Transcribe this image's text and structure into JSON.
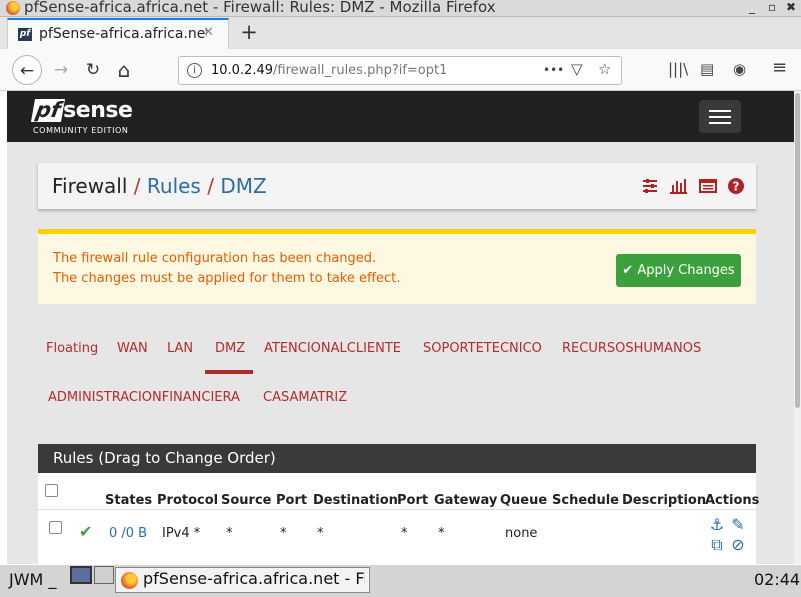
{
  "window": {
    "title": "pfSense-africa.africa.net - Firewall: Rules: DMZ - Mozilla Firefox",
    "min": "_",
    "max": "▫",
    "close": "✖"
  },
  "browser": {
    "tab_title": "pfSense-africa.africa.net -",
    "tab_close": "✕",
    "new_tab": "+",
    "url_host": "10.0.2.49",
    "url_path": "/firewall_rules.php?if=opt1",
    "back": "←",
    "forward": "→",
    "reload": "↻",
    "home": "⌂",
    "url_more": "•••",
    "pocket": "▽",
    "bookmark_star": "☆",
    "library": "|||\\",
    "sidebar": "▤",
    "account": "◉",
    "menu": "≡"
  },
  "pfsense": {
    "logo_pf": "pf",
    "logo_sense": "sense",
    "logo_edition": "COMMUNITY EDITION"
  },
  "breadcrumb": {
    "root": "Firewall",
    "sep1": "/",
    "rules": "Rules",
    "sep2": "/",
    "current": "DMZ"
  },
  "breadcrumb_icons": [
    "sliders-icon",
    "bar-chart-icon",
    "table-list-icon",
    "help-icon"
  ],
  "alert": {
    "line1": "The firewall rule configuration has been changed.",
    "line2": "The changes must be applied for them to take effect.",
    "apply_check": "✔",
    "apply_label": "Apply Changes"
  },
  "interface_tabs": {
    "row1": [
      "Floating",
      "WAN",
      "LAN",
      "DMZ",
      "ATENCIONALCLIENTE",
      "SOPORTETECNICO",
      "RECURSOSHUMANOS"
    ],
    "row2": [
      "ADMINISTRACIONFINANCIERA",
      "CASAMATRIZ"
    ],
    "active": "DMZ"
  },
  "rules_panel": {
    "heading": "Rules (Drag to Change Order)",
    "columns": [
      "States",
      "Protocol",
      "Source",
      "Port",
      "Destination",
      "Port",
      "Gateway",
      "Queue",
      "Schedule",
      "Description",
      "Actions"
    ],
    "rows": [
      {
        "status_icon": "✔",
        "states": "0 /0 B",
        "protocol": "IPv4 *",
        "source": "*",
        "source_port": "*",
        "destination": "*",
        "dest_port": "*",
        "gateway": "*",
        "queue": "none",
        "schedule": "",
        "description": ""
      }
    ],
    "action_icons": {
      "anchor": "⚓",
      "edit": "✎",
      "copy": "⧉",
      "disable": "⊘"
    }
  },
  "taskbar": {
    "wm_label": "JWM",
    "wm_underscore": "_",
    "task_label": "pfSense-africa.africa.net - Fir",
    "clock": "02:44"
  }
}
